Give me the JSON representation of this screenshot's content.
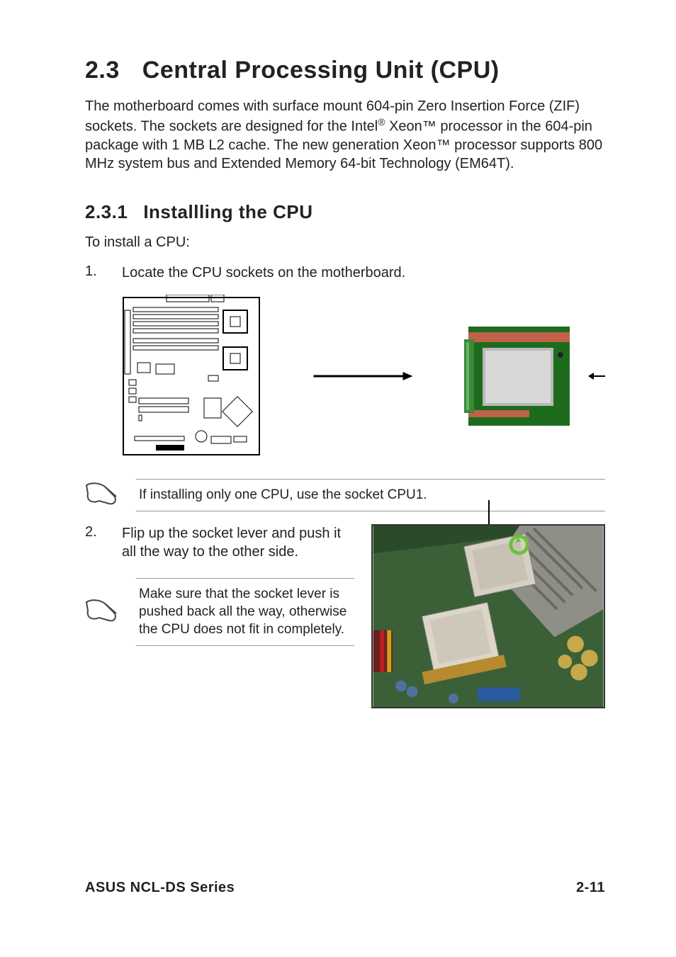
{
  "section": {
    "number": "2.3",
    "title": "Central Processing Unit (CPU)",
    "intro_html": "The motherboard comes with surface mount 604-pin Zero Insertion Force (ZIF) sockets. The sockets are designed for the Intel® Xeon™ processor in the 604-pin package with 1 MB L2 cache. The new generation Xeon™ processor supports 800 MHz system bus and Extended Memory 64-bit Technology (EM64T)."
  },
  "subsection": {
    "number": "2.3.1",
    "title": "Installling the CPU",
    "lead": "To install a CPU:",
    "steps": [
      {
        "n": "1.",
        "text": "Locate the CPU sockets on the motherboard."
      },
      {
        "n": "2.",
        "text": "Flip up the socket lever and push it all the way to the other side."
      }
    ],
    "notes": [
      {
        "text": "If installing only one CPU, use the socket CPU1."
      },
      {
        "text": "Make sure that the socket lever is pushed back all the way, otherwise the CPU does not fit in completely."
      }
    ]
  },
  "images": {
    "mobo_diagram": "motherboard-cpu-socket-diagram",
    "cpu_render": "cpu-socket-render",
    "socket_photo": "motherboard-socket-lever-photo"
  },
  "footer": {
    "left": "ASUS NCL-DS Series",
    "right": "2-11"
  }
}
